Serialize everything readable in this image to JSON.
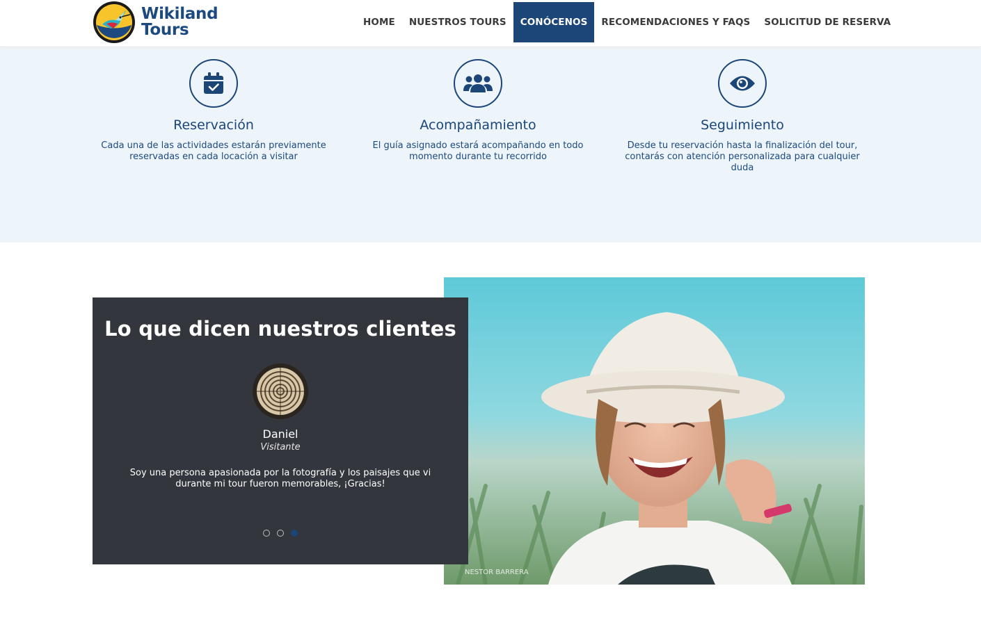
{
  "brand": {
    "name_line1": "Wikiland",
    "name_line2": "Tours",
    "logo_icon": "hummingbird-icon"
  },
  "nav": {
    "items": [
      {
        "label": "HOME",
        "active": false
      },
      {
        "label": "NUESTROS TOURS",
        "active": false
      },
      {
        "label": "CONÓCENOS",
        "active": true
      },
      {
        "label": "RECOMENDACIONES Y FAQS",
        "active": false
      },
      {
        "label": "SOLICITUD DE RESERVA",
        "active": false
      }
    ]
  },
  "features": [
    {
      "icon": "calendar-check-icon",
      "title": "Reservación",
      "description": "Cada una de las actividades estarán previamente reservadas en cada locación a visitar"
    },
    {
      "icon": "users-group-icon",
      "title": "Acompañamiento",
      "description": "El guía asignado estará acompañando en todo momento durante tu recorrido"
    },
    {
      "icon": "eye-icon",
      "title": "Seguimiento",
      "description": "Desde tu reservación hasta la finalización del tour, contarás con atención personalizada para cualquier duda"
    }
  ],
  "testimonials": {
    "heading": "Lo que dicen nuestros clientes",
    "client": {
      "name": "Daniel",
      "role": "Visitante",
      "quote": "Soy una persona apasionada por la fotografía y los paisajes que vi durante mi tour fueron memorables, ¡Gracias!"
    },
    "slides": {
      "count": 3,
      "active_index": 3
    },
    "photo_watermark": "NESTOR BARRERA"
  },
  "colors": {
    "primary": "#1b4677",
    "feature_bg": "#edf4fa",
    "testimonial_bg": "#33373d"
  }
}
